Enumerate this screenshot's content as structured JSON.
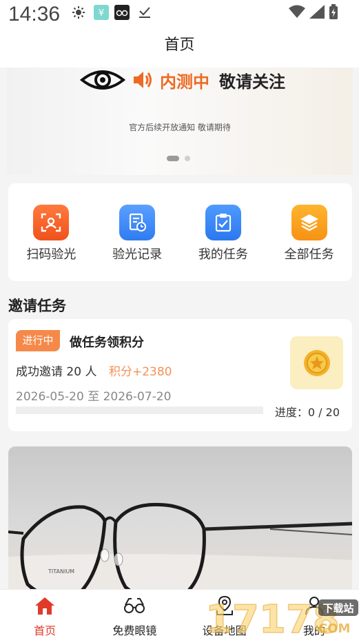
{
  "status_bar": {
    "time": "14:36",
    "icons": [
      "sun-icon",
      "yuan-icon",
      "glasses-app-icon",
      "download-done-icon",
      "wifi-icon",
      "signal-icon",
      "battery-icon"
    ]
  },
  "header": {
    "title": "首页"
  },
  "banner": {
    "eye_icon": "eye-icon",
    "speaker_icon": "speaker-icon",
    "tag": "内测中",
    "follow": "敬请关注",
    "subtitle": "官方后续开放通知 敬请期待",
    "page_count": 2,
    "active_page": 1
  },
  "quick_actions": [
    {
      "label": "扫码验光",
      "icon": "scan-icon",
      "color": "#f45f25"
    },
    {
      "label": "验光记录",
      "icon": "record-icon",
      "color": "#3b8bf5"
    },
    {
      "label": "我的任务",
      "icon": "task-icon",
      "color": "#2f86f3"
    },
    {
      "label": "全部任务",
      "icon": "layers-icon",
      "color": "#fba31c"
    }
  ],
  "invite_section": {
    "title": "邀请任务",
    "task": {
      "status": "进行中",
      "name": "做任务领积分",
      "desc": "成功邀请 20 人",
      "points": "积分+2380",
      "date_range": "2026-05-20 至 2026-07-20",
      "progress_text": "进度：0 / 20",
      "progress_fraction": 0,
      "icon": "coin-icon"
    }
  },
  "product": {
    "image": "glasses-photo"
  },
  "tabbar": {
    "items": [
      {
        "label": "首页",
        "icon": "home-icon",
        "active": true
      },
      {
        "label": "免费眼镜",
        "icon": "glasses-icon",
        "active": false
      },
      {
        "label": "设备地图",
        "icon": "map-pin-icon",
        "active": false
      },
      {
        "label": "我的",
        "icon": "user-icon",
        "active": false
      }
    ],
    "active_color": "#e03a2a"
  },
  "watermark": {
    "text": "17178",
    "site": "下载站",
    "suffix": "COM"
  }
}
